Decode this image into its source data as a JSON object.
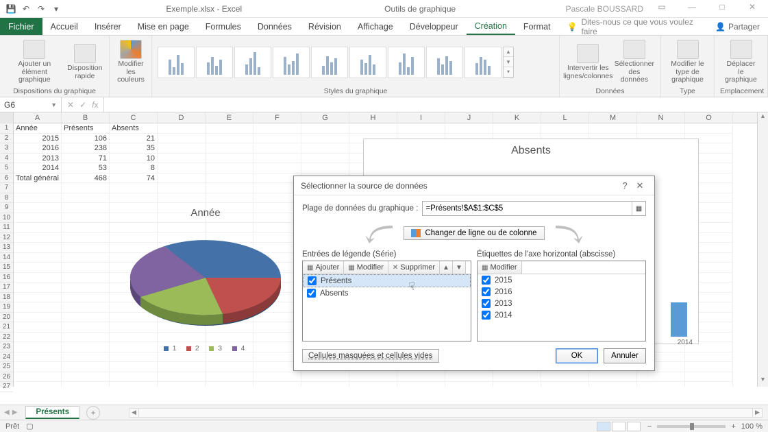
{
  "titlebar": {
    "document_title": "Exemple.xlsx - Excel",
    "tool_context": "Outils de graphique",
    "user_name": "Pascale BOUSSARD"
  },
  "ribbon_tabs": {
    "fichier": "Fichier",
    "accueil": "Accueil",
    "insertion": "Insérer",
    "mise_en_page": "Mise en page",
    "formules": "Formules",
    "donnees": "Données",
    "revision": "Révision",
    "affichage": "Affichage",
    "developpeur": "Développeur",
    "creation": "Création",
    "format": "Format",
    "tell_me_placeholder": "Dites-nous ce que vous voulez faire",
    "share": "Partager"
  },
  "ribbon_groups": {
    "dispositions": "Dispositions du graphique",
    "styles": "Styles du graphique",
    "donnees": "Données",
    "type": "Type",
    "emplacement": "Emplacement",
    "btn_ajouter_element": "Ajouter un élément\ngraphique",
    "btn_disposition": "Disposition\nrapide",
    "btn_couleurs": "Modifier les\ncouleurs",
    "btn_intervertir": "Intervertir les\nlignes/colonnes",
    "btn_selectionner": "Sélectionner\ndes données",
    "btn_modifier_type": "Modifier le type\nde graphique",
    "btn_deplacer": "Déplacer le\ngraphique"
  },
  "formula_bar": {
    "namebox": "G6",
    "formula": ""
  },
  "columns": [
    "A",
    "B",
    "C",
    "D",
    "E",
    "F",
    "G",
    "H",
    "I",
    "J",
    "K",
    "L",
    "M",
    "N",
    "O"
  ],
  "table": {
    "headers": [
      "Année",
      "Présents",
      "Absents"
    ],
    "rows": [
      [
        "2015",
        "106",
        "21"
      ],
      [
        "2016",
        "238",
        "35"
      ],
      [
        "2013",
        "71",
        "10"
      ],
      [
        "2014",
        "53",
        "8"
      ],
      [
        "Total général",
        "468",
        "74"
      ]
    ]
  },
  "pie_chart": {
    "title": "Année",
    "legend_items": [
      "1",
      "2",
      "3",
      "4"
    ],
    "legend_colors": [
      "#4472a8",
      "#c0504d",
      "#9bbb59",
      "#8064a2"
    ]
  },
  "bar_chart": {
    "title": "Absents",
    "visible_label": "2014"
  },
  "dialog": {
    "title": "Sélectionner la source de données",
    "range_label": "Plage de données du graphique :",
    "range_value": "=Présents!$A$1:$C$5",
    "swap_button": "Changer de ligne ou de colonne",
    "series_header": "Entrées de légende (Série)",
    "axis_header": "Étiquettes de l'axe horizontal (abscisse)",
    "btn_ajouter": "Ajouter",
    "btn_modifier": "Modifier",
    "btn_supprimer": "Supprimer",
    "series": [
      "Présents",
      "Absents"
    ],
    "axis_labels": [
      "2015",
      "2016",
      "2013",
      "2014"
    ],
    "hidden_cells": "Cellules masquées et cellules vides",
    "ok": "OK",
    "cancel": "Annuler"
  },
  "sheet_tabs": {
    "active": "Présents"
  },
  "statusbar": {
    "ready": "Prêt",
    "zoom": "100 %"
  },
  "chart_data": [
    {
      "type": "pie",
      "title": "Année",
      "categories": [
        "2015",
        "2016",
        "2013",
        "2014"
      ],
      "values": [
        106,
        238,
        71,
        53
      ],
      "colors": [
        "#4472a8",
        "#c0504d",
        "#9bbb59",
        "#8064a2"
      ],
      "is_3d": true
    },
    {
      "type": "bar",
      "title": "Absents",
      "categories": [
        "2015",
        "2016",
        "2013",
        "2014"
      ],
      "values": [
        21,
        35,
        10,
        8
      ],
      "xlabel": "",
      "ylabel": "",
      "ylim": [
        0,
        40
      ],
      "note": "chart mostly obscured by dialog in screenshot"
    }
  ]
}
